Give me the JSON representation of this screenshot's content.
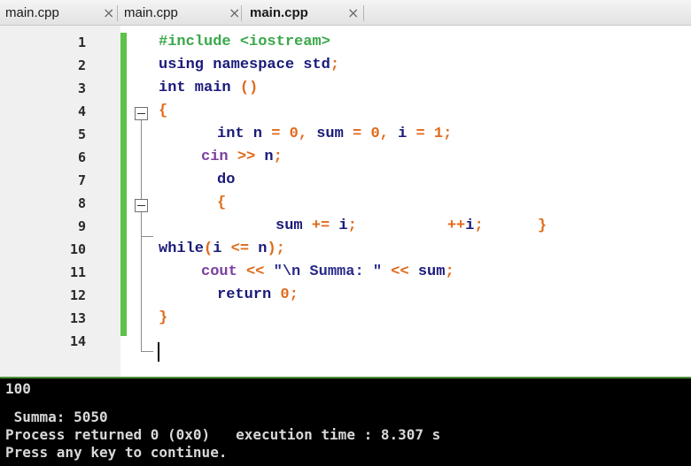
{
  "tabs": [
    {
      "label": "main.cpp",
      "active": false
    },
    {
      "label": "main.cpp",
      "active": false
    },
    {
      "label": "main.cpp",
      "active": true
    }
  ],
  "tab_close_glyph": "×",
  "editor": {
    "lines": [
      {
        "num": "1",
        "parts": [
          {
            "t": "#include <iostream>",
            "c": "pre"
          }
        ]
      },
      {
        "num": "2",
        "parts": [
          {
            "t": "using namespace std",
            "c": "kw"
          },
          {
            "t": ";",
            "c": "op"
          }
        ]
      },
      {
        "num": "3",
        "parts": [
          {
            "t": "int main ",
            "c": "kw"
          },
          {
            "t": "()",
            "c": "op"
          }
        ]
      },
      {
        "num": "4",
        "parts": [
          {
            "t": "{",
            "c": "op"
          }
        ]
      },
      {
        "num": "5",
        "parts": [
          {
            "t": "int n ",
            "c": "kw"
          },
          {
            "t": "= ",
            "c": "op"
          },
          {
            "t": "0",
            "c": "num"
          },
          {
            "t": ", ",
            "c": "op"
          },
          {
            "t": "sum ",
            "c": "id"
          },
          {
            "t": "= ",
            "c": "op"
          },
          {
            "t": "0",
            "c": "num"
          },
          {
            "t": ", ",
            "c": "op"
          },
          {
            "t": "i ",
            "c": "id"
          },
          {
            "t": "= ",
            "c": "op"
          },
          {
            "t": "1",
            "c": "num"
          },
          {
            "t": ";",
            "c": "op"
          }
        ]
      },
      {
        "num": "6",
        "parts": [
          {
            "t": "cin ",
            "c": "cin"
          },
          {
            "t": ">> ",
            "c": "op"
          },
          {
            "t": "n",
            "c": "id"
          },
          {
            "t": ";",
            "c": "op"
          }
        ]
      },
      {
        "num": "7",
        "parts": [
          {
            "t": "do",
            "c": "kw"
          }
        ]
      },
      {
        "num": "8",
        "parts": [
          {
            "t": "{",
            "c": "op"
          }
        ]
      },
      {
        "num": "9",
        "parts": [
          {
            "t": "sum ",
            "c": "id"
          },
          {
            "t": "+= ",
            "c": "op"
          },
          {
            "t": "i",
            "c": "id"
          },
          {
            "t": ";",
            "c": "op"
          },
          {
            "t": "          ++",
            "c": "op"
          },
          {
            "t": "i",
            "c": "id"
          },
          {
            "t": ";",
            "c": "op"
          },
          {
            "t": "      }",
            "c": "op"
          }
        ]
      },
      {
        "num": "10",
        "parts": [
          {
            "t": "while",
            "c": "kw"
          },
          {
            "t": "(",
            "c": "op"
          },
          {
            "t": "i ",
            "c": "id"
          },
          {
            "t": "<= ",
            "c": "op"
          },
          {
            "t": "n",
            "c": "id"
          },
          {
            "t": ");",
            "c": "op"
          }
        ]
      },
      {
        "num": "11",
        "parts": [
          {
            "t": "cout ",
            "c": "cin"
          },
          {
            "t": "<< ",
            "c": "op"
          },
          {
            "t": "\"\\n Summa: \"",
            "c": "str"
          },
          {
            "t": " << ",
            "c": "op"
          },
          {
            "t": "sum",
            "c": "id"
          },
          {
            "t": ";",
            "c": "op"
          }
        ]
      },
      {
        "num": "12",
        "parts": [
          {
            "t": "return ",
            "c": "kw"
          },
          {
            "t": "0",
            "c": "num"
          },
          {
            "t": ";",
            "c": "op"
          }
        ]
      },
      {
        "num": "13",
        "parts": [
          {
            "t": "}",
            "c": "op"
          }
        ]
      },
      {
        "num": "14",
        "parts": []
      }
    ]
  },
  "console": {
    "lines": [
      "100",
      "",
      " Summa: 5050",
      "Process returned 0 (0x0)   execution time : 8.307 s",
      "Press any key to continue."
    ]
  },
  "colors": {
    "change_bar": "#5fc14a",
    "console_bg": "#000000",
    "gutter_bg": "#f0f0f0"
  }
}
